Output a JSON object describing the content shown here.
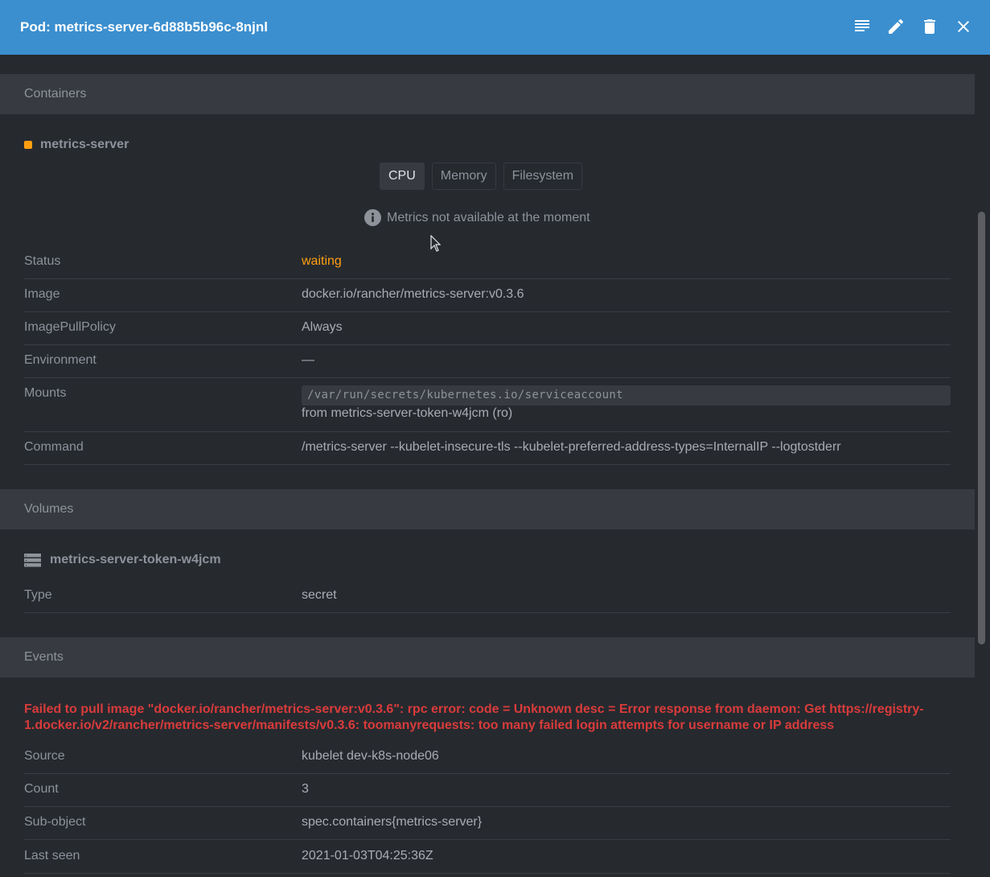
{
  "header": {
    "title": "Pod: metrics-server-6d88b5b96c-8njnl",
    "actions": [
      {
        "name": "logs",
        "icon": "list-icon"
      },
      {
        "name": "edit",
        "icon": "pencil-icon"
      },
      {
        "name": "delete",
        "icon": "trash-icon"
      },
      {
        "name": "close",
        "icon": "close-icon"
      }
    ]
  },
  "containers": {
    "section_title": "Containers",
    "container": {
      "name": "metrics-server",
      "status_color": "#ff9f0f",
      "metric_tabs": [
        {
          "label": "CPU",
          "active": true
        },
        {
          "label": "Memory",
          "active": false
        },
        {
          "label": "Filesystem",
          "active": false
        }
      ],
      "metrics_message": "Metrics not available at the moment",
      "fields": {
        "status": {
          "label": "Status",
          "value": "waiting"
        },
        "image": {
          "label": "Image",
          "value": "docker.io/rancher/metrics-server:v0.3.6"
        },
        "pull_policy": {
          "label": "ImagePullPolicy",
          "value": "Always"
        },
        "environment": {
          "label": "Environment",
          "value": "—"
        },
        "mounts": {
          "label": "Mounts",
          "path": "/var/run/secrets/kubernetes.io/serviceaccount",
          "source": "from metrics-server-token-w4jcm (ro)"
        },
        "command": {
          "label": "Command",
          "value": "/metrics-server --kubelet-insecure-tls --kubelet-preferred-address-types=InternalIP --logtostderr"
        }
      }
    }
  },
  "volumes": {
    "section_title": "Volumes",
    "volume": {
      "name": "metrics-server-token-w4jcm",
      "type_label": "Type",
      "type_value": "secret"
    }
  },
  "events": {
    "section_title": "Events",
    "event": {
      "message": "Failed to pull image \"docker.io/rancher/metrics-server:v0.3.6\": rpc error: code = Unknown desc = Error response from daemon: Get https://registry-1.docker.io/v2/rancher/metrics-server/manifests/v0.3.6: toomanyrequests: too many failed login attempts for username or IP address",
      "message_color": "#d93b3b",
      "fields": {
        "source": {
          "label": "Source",
          "value": "kubelet dev-k8s-node06"
        },
        "count": {
          "label": "Count",
          "value": "3"
        },
        "subobject": {
          "label": "Sub-object",
          "value": "spec.containers{metrics-server}"
        },
        "last_seen": {
          "label": "Last seen",
          "value": "2021-01-03T04:25:36Z"
        }
      }
    }
  },
  "colors": {
    "header_bg": "#3b8fcf",
    "page_bg": "#262a2f",
    "section_bg": "#373a40",
    "warning": "#ff9f0f",
    "error": "#d93b3b"
  }
}
